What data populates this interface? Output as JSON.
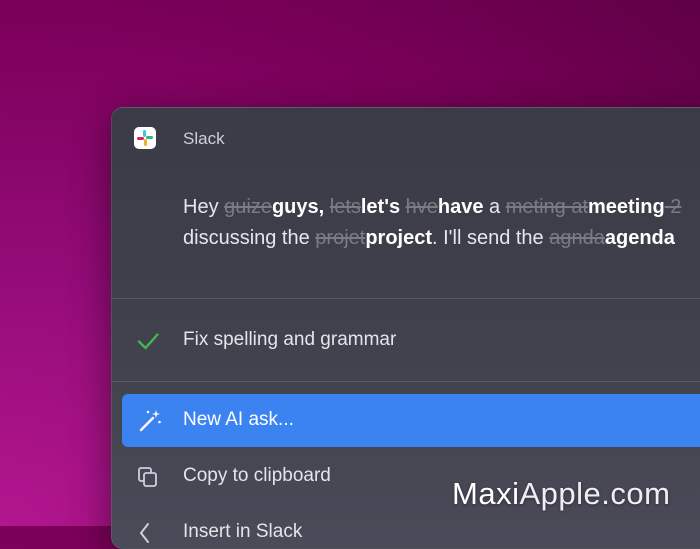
{
  "app": {
    "name": "Slack",
    "icon": "slack-icon"
  },
  "message": {
    "line1": [
      {
        "t": "Hey ",
        "k": "plain"
      },
      {
        "t": "guize",
        "k": "del"
      },
      {
        "t": "guys,",
        "k": "ins"
      },
      {
        "t": " ",
        "k": "plain"
      },
      {
        "t": "lets",
        "k": "del"
      },
      {
        "t": "let's",
        "k": "ins"
      },
      {
        "t": " ",
        "k": "plain"
      },
      {
        "t": "hve",
        "k": "del"
      },
      {
        "t": "have",
        "k": "ins"
      },
      {
        "t": " a ",
        "k": "plain"
      },
      {
        "t": "meting at",
        "k": "del"
      },
      {
        "t": "meeting",
        "k": "ins"
      },
      {
        "t": " 2",
        "k": "del"
      }
    ],
    "line2": [
      {
        "t": "discussing the ",
        "k": "plain"
      },
      {
        "t": "projet",
        "k": "del"
      },
      {
        "t": "project",
        "k": "ins"
      },
      {
        "t": ". I'll send the ",
        "k": "plain"
      },
      {
        "t": "agnda",
        "k": "del"
      },
      {
        "t": "agenda",
        "k": "ins"
      }
    ]
  },
  "menu": {
    "fix_label": "Fix spelling and grammar",
    "new_ai_label": "New AI ask...",
    "copy_label": "Copy to clipboard",
    "partial_label": "Insert in Slack"
  },
  "watermark": {
    "brand": "Maxi",
    "rest": "Apple.com"
  },
  "colors": {
    "accent": "#3b83f0",
    "check": "#3fb950",
    "background": "#930b77"
  }
}
